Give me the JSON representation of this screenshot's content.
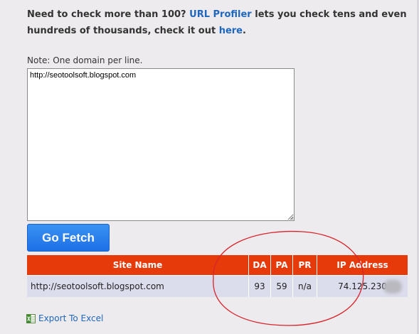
{
  "intro": {
    "text_before": "Need to check more than 100? ",
    "link_url_profiler": "URL Profiler",
    "text_middle": " lets you check tens and even hundreds of thousands, check it out ",
    "link_here": "here",
    "text_after": "."
  },
  "input": {
    "note": "Note: One domain per line.",
    "value": "http://seotoolsoft.blogspot.com"
  },
  "button": {
    "label": "Go Fetch"
  },
  "table": {
    "headers": [
      "Site Name",
      "DA",
      "PA",
      "PR",
      "IP Address"
    ],
    "rows": [
      {
        "site": "http://seotoolsoft.blogspot.com",
        "da": "93",
        "pa": "59",
        "pr": "n/a",
        "ip": "74.125.230"
      }
    ]
  },
  "export": {
    "label": "Export To Excel"
  },
  "colors": {
    "header_bg": "#e73a0b",
    "row_bg": "#dbdcec",
    "button_bg": "#2a82ee",
    "link": "#1d67bd",
    "annotation": "#d8232a",
    "page_bg": "#eeebee"
  },
  "icons": {
    "export": "excel-icon",
    "resize": "resize-grip-icon"
  }
}
